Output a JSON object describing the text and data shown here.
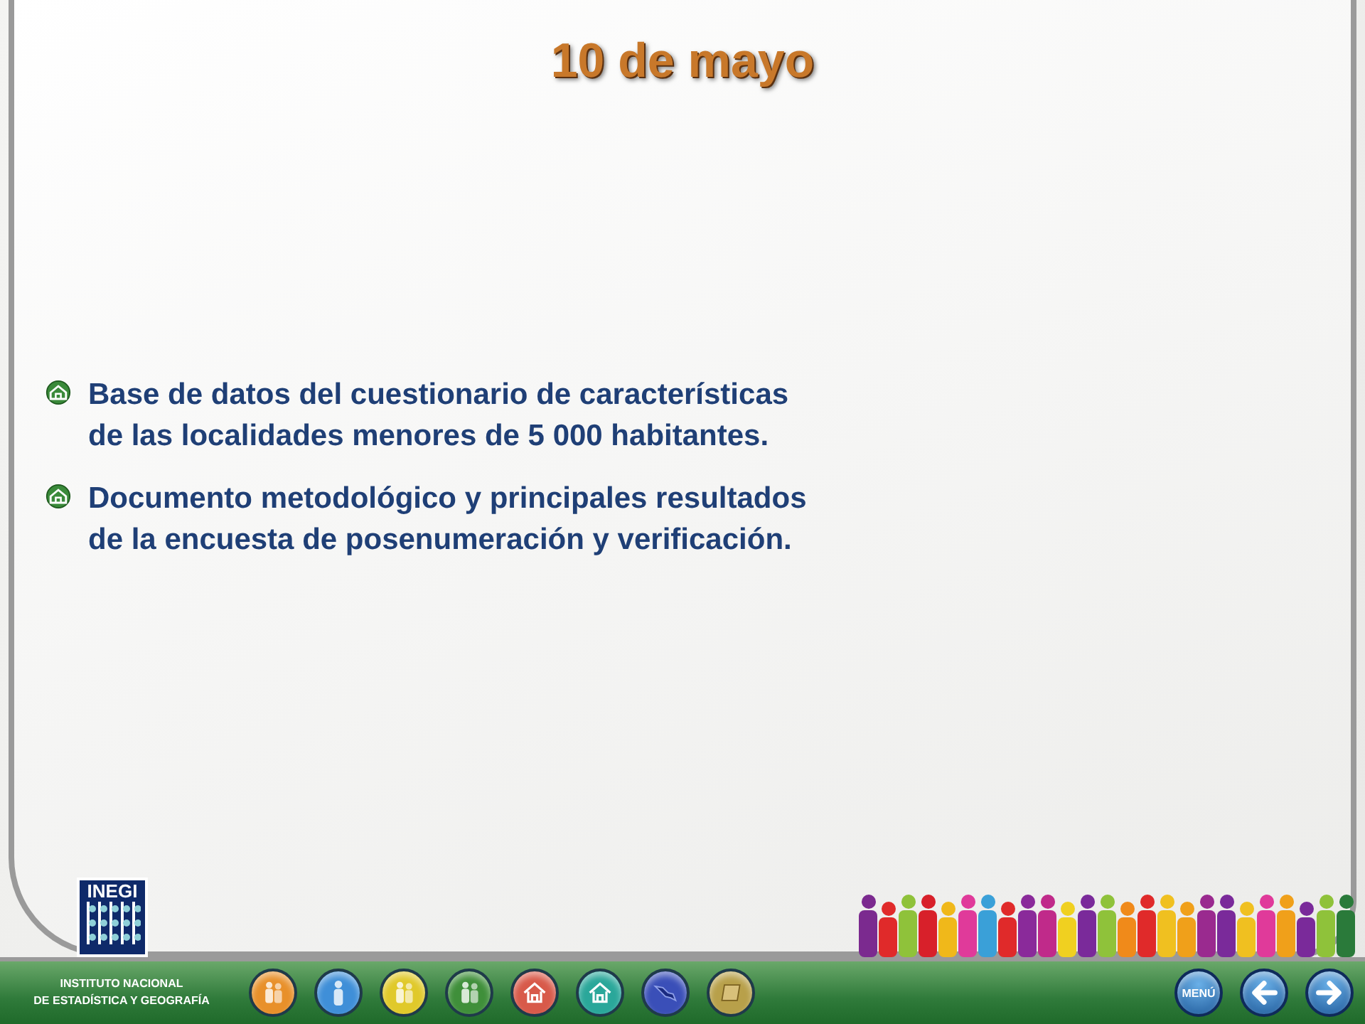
{
  "slide": {
    "title": "10 de mayo",
    "bullets": [
      {
        "lines": [
          "Base de datos del cuestionario de características",
          "de las localidades menores de 5 000 habitantes."
        ]
      },
      {
        "lines": [
          "Documento metodológico y principales resultados",
          "de la encuesta de posenumeración y verificación."
        ]
      }
    ]
  },
  "footer": {
    "logo_text": "INEGI",
    "institution": [
      "INSTITUTO NACIONAL",
      "DE ESTADÍSTICA Y GEOGRAFÍA"
    ],
    "menu_button": "MENÚ"
  }
}
